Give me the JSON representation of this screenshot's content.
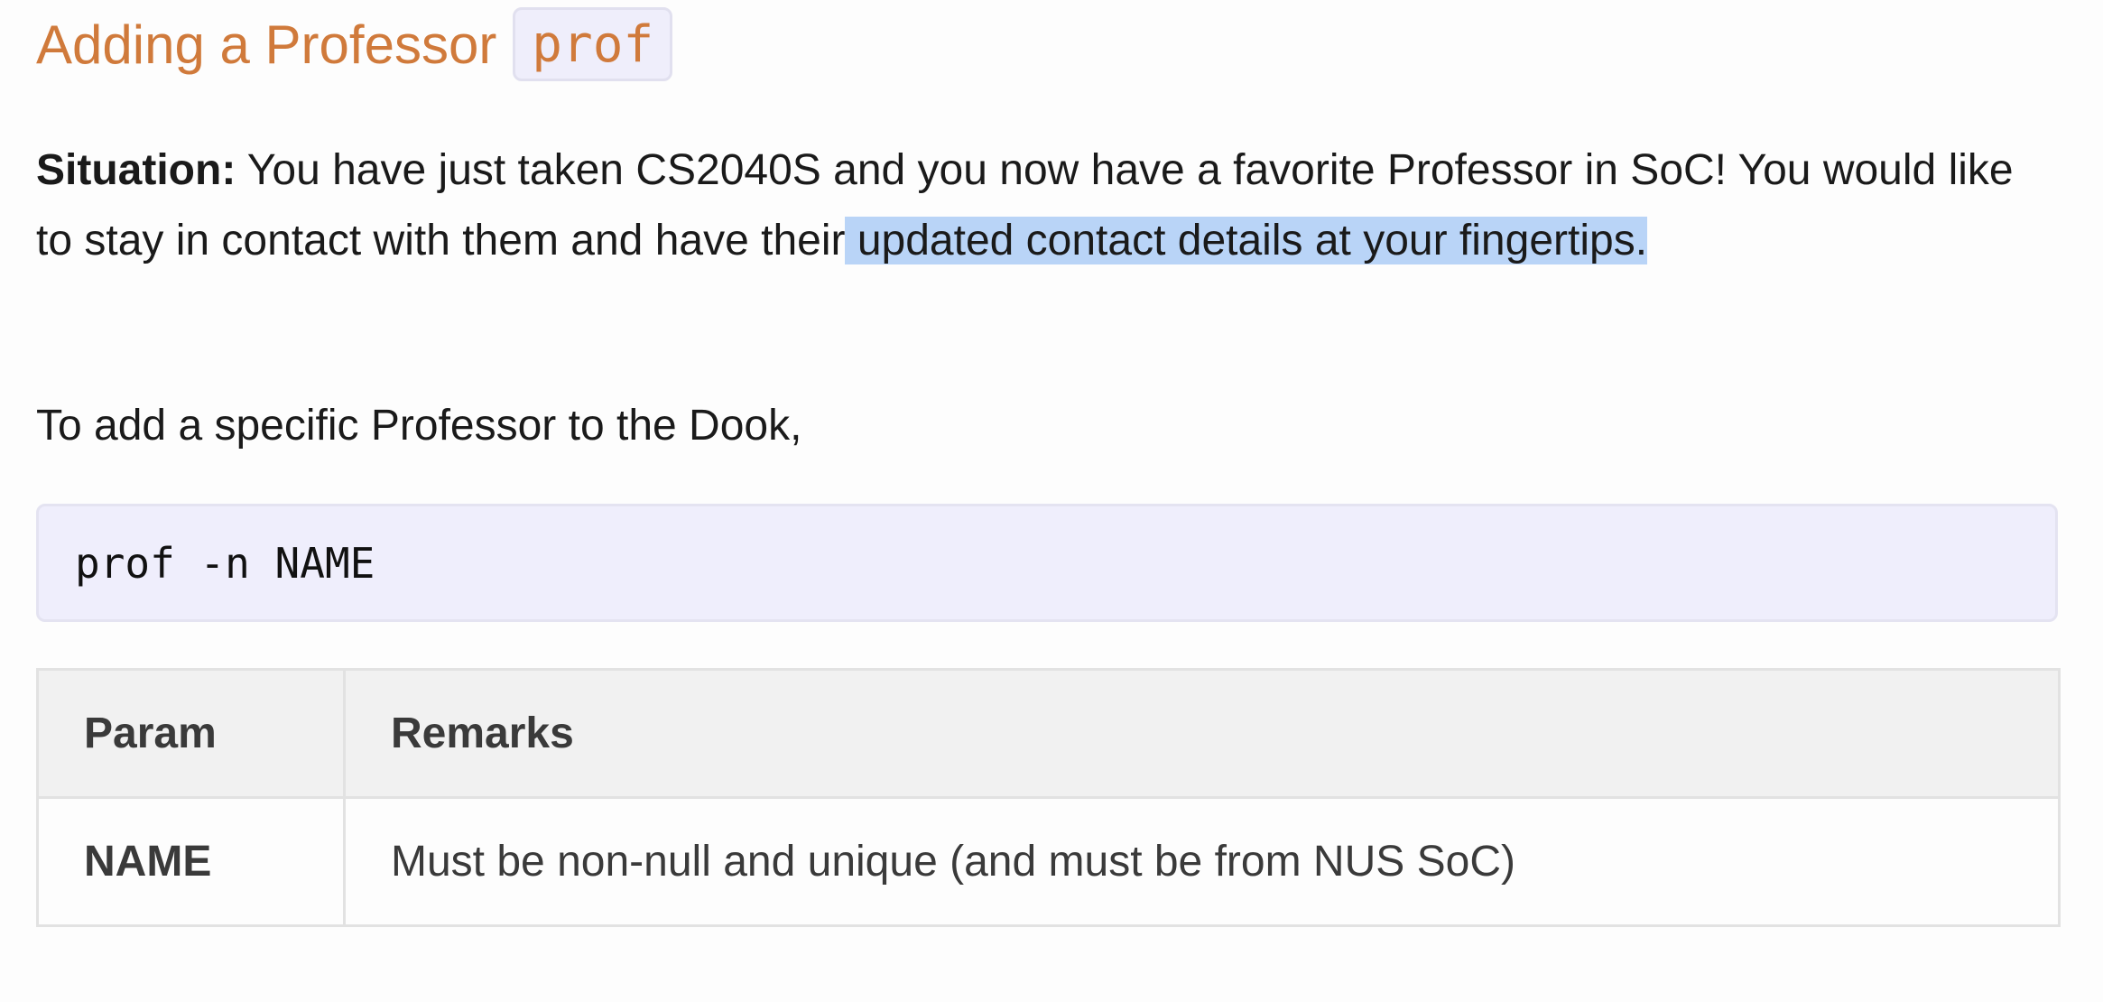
{
  "heading": {
    "text": "Adding a Professor",
    "code": "prof"
  },
  "situation": {
    "label": "Situation:",
    "text_before": " You have just taken CS2040S and you now have a favorite Professor in SoC! You would like to stay in contact with them and have their",
    "text_highlighted": " updated contact details at your fingertips."
  },
  "intro": "To add a specific Professor to the Dook,",
  "command": "prof -n NAME",
  "table": {
    "headers": [
      "Param",
      "Remarks"
    ],
    "rows": [
      {
        "param": "NAME",
        "remarks": "Must be non-null and unique (and must be from NUS SoC)"
      }
    ]
  },
  "colors": {
    "heading": "#d07a3b",
    "highlight": "#b9d4f7",
    "code_background": "#efeefc",
    "table_header_background": "#f1f1f1"
  }
}
